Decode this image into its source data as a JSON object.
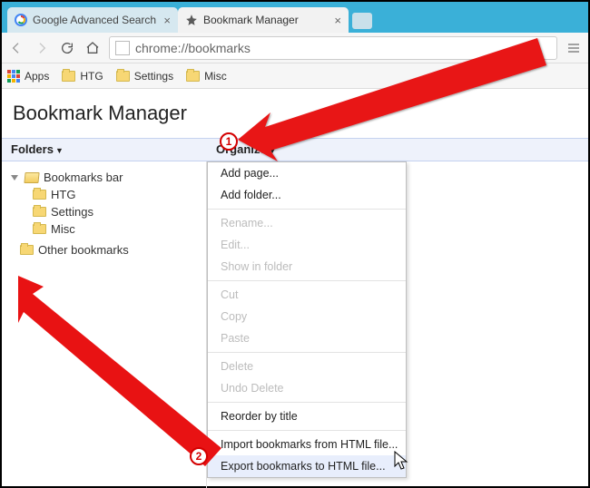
{
  "tabs": [
    {
      "label": "Google Advanced Search",
      "active": false,
      "favicon": "google"
    },
    {
      "label": "Bookmark Manager",
      "active": true,
      "favicon": "star"
    }
  ],
  "omnibox": {
    "url": "chrome://bookmarks"
  },
  "bookmarks_bar": {
    "apps_label": "Apps",
    "items": [
      "HTG",
      "Settings",
      "Misc"
    ]
  },
  "page": {
    "title": "Bookmark Manager",
    "folders_label": "Folders",
    "organize_label": "Organize"
  },
  "tree": {
    "root1": "Bookmarks bar",
    "children": [
      "HTG",
      "Settings",
      "Misc"
    ],
    "root2": "Other bookmarks"
  },
  "menu": {
    "add_page": "Add page...",
    "add_folder": "Add folder...",
    "rename": "Rename...",
    "edit": "Edit...",
    "show_in_folder": "Show in folder",
    "cut": "Cut",
    "copy": "Copy",
    "paste": "Paste",
    "delete": "Delete",
    "undo_delete": "Undo Delete",
    "reorder": "Reorder by title",
    "import": "Import bookmarks from HTML file...",
    "export": "Export bookmarks to HTML file..."
  },
  "annotations": {
    "badge1": "1",
    "badge2": "2"
  }
}
